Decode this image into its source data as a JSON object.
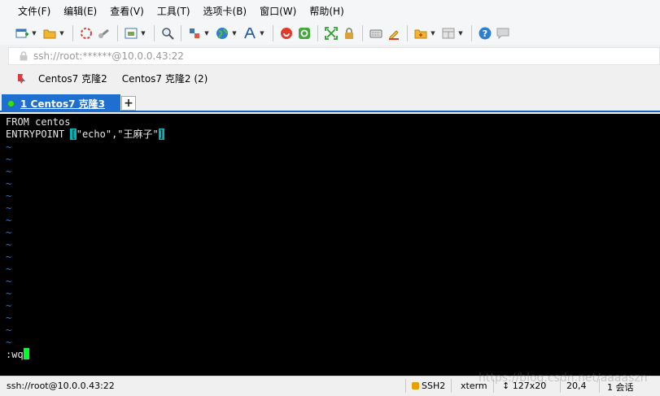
{
  "menu": [
    "文件(F)",
    "编辑(E)",
    "查看(V)",
    "工具(T)",
    "选项卡(B)",
    "窗口(W)",
    "帮助(H)"
  ],
  "toolbar_icons": [
    "new-session-icon",
    "open-folder-icon",
    "disconnect-icon",
    "reconnect-icon",
    "properties-icon",
    "find-icon",
    "transfer-icon",
    "globe-icon",
    "font-icon",
    "xftp-icon",
    "xmanager-icon",
    "fullscreen-icon",
    "lock-icon",
    "keyboard-icon",
    "highlight-icon",
    "new-tab-group-icon",
    "layout-icon",
    "help-icon",
    "chat-icon"
  ],
  "address": {
    "text": "ssh://root:******@10.0.0.43:22"
  },
  "links": [
    "Centos7 克隆2",
    "Centos7 克隆2 (2)"
  ],
  "tab": {
    "number": "1",
    "label": "Centos7 克隆3",
    "status_color": "#37e400"
  },
  "terminal": {
    "line1": "FROM centos",
    "line2_prefix": "ENTRYPOINT ",
    "line2_open": "[",
    "line2_body": "\"echo\",\"王麻子\"",
    "line2_close": "]",
    "tilde": "~",
    "command": ":wq"
  },
  "status": {
    "connection": "ssh://root@10.0.0.43:22",
    "protocol": "SSH2",
    "term": "xterm",
    "size": "127x20",
    "cursor": "20,4",
    "sessions": "1 会话"
  },
  "watermark": "https://blog.csdn.net/aaaaszn"
}
